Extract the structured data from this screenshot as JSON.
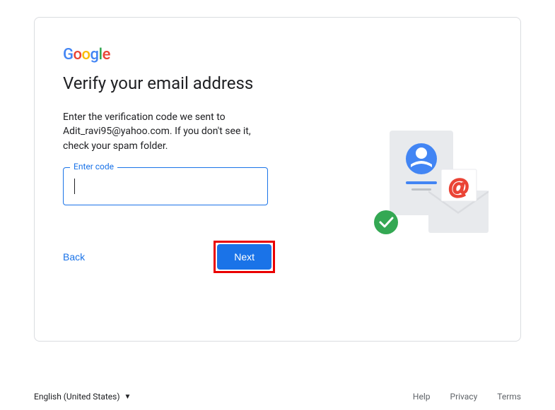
{
  "logo": {
    "g1": "G",
    "o1": "o",
    "o2": "o",
    "g2": "g",
    "l": "l",
    "e": "e"
  },
  "heading": "Verify your email address",
  "description": "Enter the verification code we sent to Adit_ravi95@yahoo.com. If you don't see it, check your spam folder.",
  "input": {
    "label": "Enter code",
    "value": ""
  },
  "buttons": {
    "back": "Back",
    "next": "Next"
  },
  "footer": {
    "language": "English (United States)",
    "help": "Help",
    "privacy": "Privacy",
    "terms": "Terms"
  }
}
